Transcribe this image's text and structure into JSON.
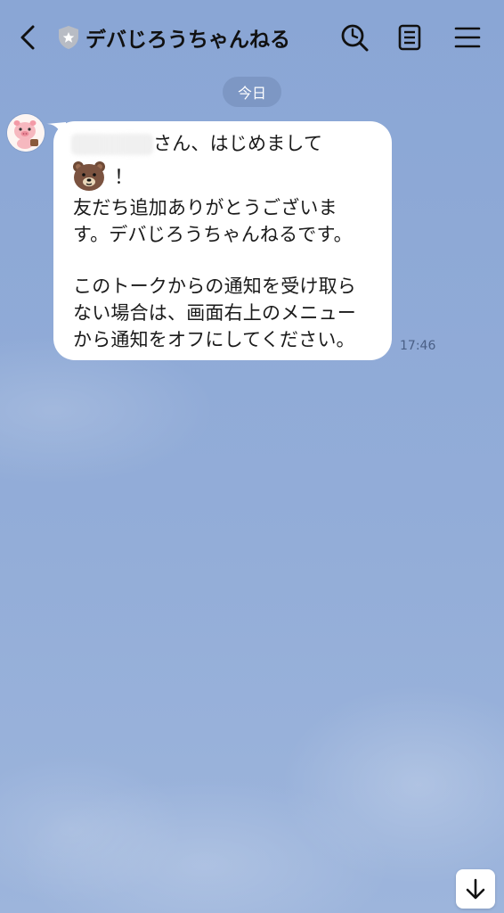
{
  "header": {
    "title": "デバじろうちゃんねる",
    "back_icon": "chevron-left-icon",
    "verified_icon": "shield-star-icon",
    "search_icon": "search-icon",
    "notes_icon": "notes-icon",
    "menu_icon": "hamburger-menu-icon"
  },
  "chat": {
    "date_label": "今日",
    "message": {
      "greeting": "さん、はじめまして",
      "sticker_icon": "brown-bear-emoji-icon",
      "exclaim": "！",
      "line1": "友だち追加ありがとうございま",
      "line2": "す。デバじろうちゃんねるです。",
      "line3": "このトークからの通知を受け取ら",
      "line4": "ない場合は、画面右上のメニュー",
      "line5": "から通知をオフにしてください。",
      "time": "17:46"
    }
  },
  "scroll_button": {
    "icon": "arrow-down-icon"
  },
  "colors": {
    "background": "#8fa9d6",
    "bubble": "#ffffff",
    "date_pill": "#7891be"
  }
}
